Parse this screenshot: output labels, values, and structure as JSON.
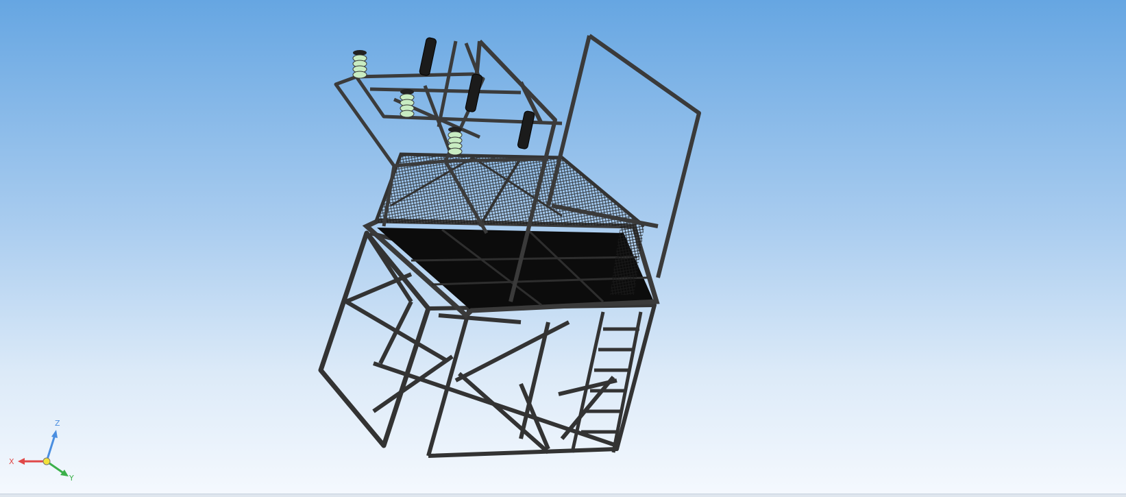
{
  "scene": {
    "background_top": "#66a6e2",
    "background_bottom": "#f5f9fe",
    "model": "steel-frame-platform-with-insulators",
    "frame_color": "#3a3a3a",
    "mesh_color": "#101010",
    "insulator_color": "#c8ecc2"
  },
  "triad": {
    "x_label": "X",
    "y_label": "Y",
    "z_label": "Z",
    "x_color": "#e04848",
    "y_color": "#3bb04a",
    "z_color": "#4a8ee0"
  }
}
